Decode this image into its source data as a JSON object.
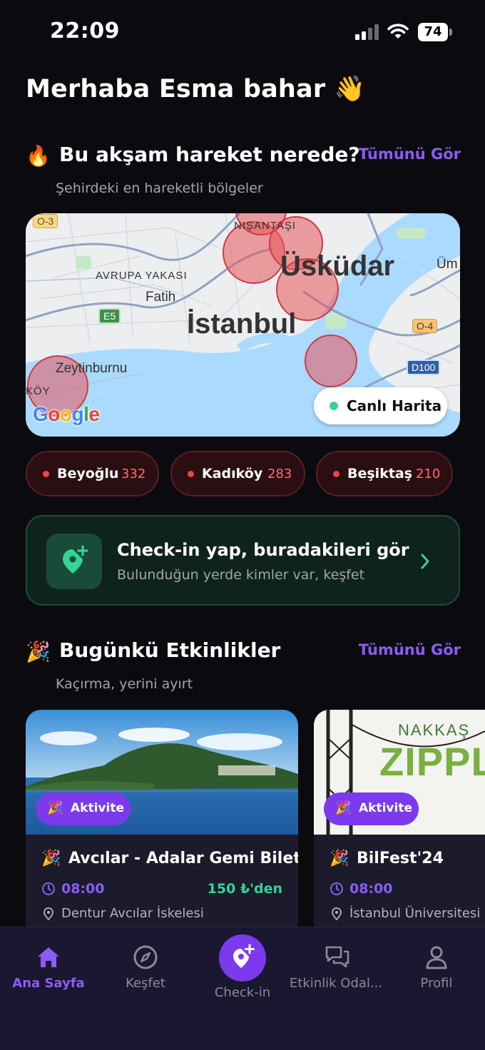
{
  "status_bar": {
    "time": "22:09",
    "battery": "74"
  },
  "greeting": "Merhaba Esma bahar 👋",
  "hot_section": {
    "emoji": "🔥",
    "title": "Bu akşam hareket nerede?",
    "see_all": "Tümünü Gör",
    "subtitle": "Şehirdeki en hareketli bölgeler"
  },
  "map": {
    "labels": {
      "nisantasi": "NIŞANTAŞI",
      "uskudar": "Üsküdar",
      "avrupa": "AVRUPA YAKASI",
      "fatih": "Fatih",
      "istanbul": "İstanbul",
      "zeytinburnu": "Zeytinburnu",
      "koy": "KÖY",
      "um": "Üm",
      "o3": "O-3",
      "o4": "O-4",
      "e5": "E5",
      "d100": "D100"
    },
    "live_button": "Canlı Harita",
    "colors": {
      "water": "#aadaff",
      "hotspot": "#e8565a"
    }
  },
  "districts": [
    {
      "name": "Beyoğlu",
      "count": "332"
    },
    {
      "name": "Kadıköy",
      "count": "283"
    },
    {
      "name": "Beşiktaş",
      "count": "210"
    }
  ],
  "checkin_card": {
    "title": "Check-in yap, buradakileri gör",
    "subtitle": "Bulunduğun yerde kimler var, keşfet"
  },
  "events_section": {
    "emoji": "🎉",
    "title": "Bugünkü Etkinlikler",
    "see_all": "Tümünü Gör",
    "subtitle": "Kaçırma, yerini ayırt"
  },
  "events": [
    {
      "tag": "Aktivite",
      "emoji": "🎉",
      "name": "Avcılar - Adalar Gemi Bileti",
      "time": "08:00",
      "price": "150 ₺'den",
      "location": "Dentur Avcılar İskelesi"
    },
    {
      "tag": "Aktivite",
      "emoji": "🎉",
      "name": "BilFest'24",
      "time": "08:00",
      "location": "İstanbul Üniversitesi",
      "image_text_1": "NAKKAŞ",
      "image_text_2": "ZIPPLI"
    }
  ],
  "nav": {
    "home": "Ana Sayfa",
    "explore": "Keşfet",
    "checkin": "Check-in",
    "rooms": "Etkinlik Odal...",
    "profile": "Profil"
  },
  "accent_color": "#8b5cf6"
}
